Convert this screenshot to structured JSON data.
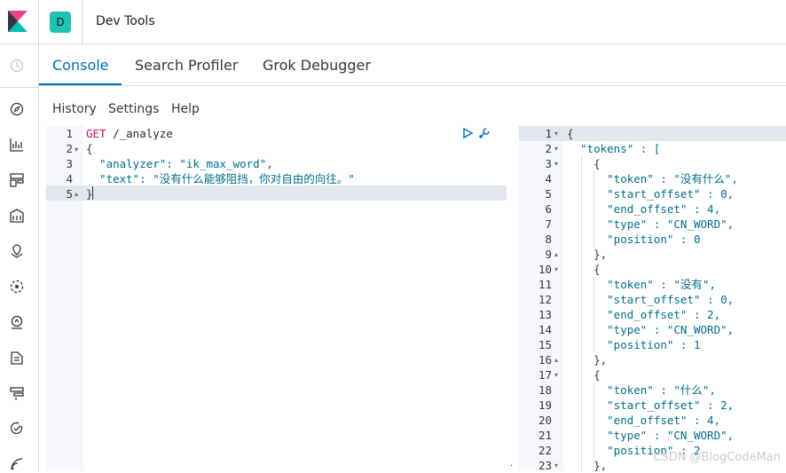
{
  "header": {
    "app_badge": "D",
    "title": "Dev Tools"
  },
  "sidenav": {
    "icons": [
      "clock-icon",
      "compass-icon",
      "visualize-icon",
      "dashboard-icon",
      "canvas-icon",
      "maps-icon",
      "ml-icon",
      "metrics-icon",
      "logs-icon",
      "apm-icon",
      "uptime-icon",
      "siem-icon"
    ]
  },
  "tabs": [
    {
      "label": "Console",
      "active": true
    },
    {
      "label": "Search Profiler",
      "active": false
    },
    {
      "label": "Grok Debugger",
      "active": false
    }
  ],
  "menu": {
    "history": "History",
    "settings": "Settings",
    "help": "Help"
  },
  "request": {
    "line_numbers": [
      "1",
      "2",
      "3",
      "4",
      "5"
    ],
    "method": "GET",
    "path": " /_analyze",
    "lines": [
      "{",
      "  \"analyzer\": \"ik_max_word\",",
      "  \"text\": \"没有什么能够阻挡，你对自由的向往。\"",
      "}"
    ]
  },
  "response": {
    "line_numbers": [
      "1",
      "2",
      "3",
      "4",
      "5",
      "6",
      "7",
      "8",
      "9",
      "10",
      "11",
      "12",
      "13",
      "14",
      "15",
      "16",
      "17",
      "18",
      "19",
      "20",
      "21",
      "22",
      "23"
    ],
    "lines": [
      "{",
      "  \"tokens\" : [",
      "    {",
      "      \"token\" : \"没有什么\",",
      "      \"start_offset\" : 0,",
      "      \"end_offset\" : 4,",
      "      \"type\" : \"CN_WORD\",",
      "      \"position\" : 0",
      "    },",
      "    {",
      "      \"token\" : \"没有\",",
      "      \"start_offset\" : 0,",
      "      \"end_offset\" : 2,",
      "      \"type\" : \"CN_WORD\",",
      "      \"position\" : 1",
      "    },",
      "    {",
      "      \"token\" : \"什么\",",
      "      \"start_offset\" : 2,",
      "      \"end_offset\" : 4,",
      "      \"type\" : \"CN_WORD\",",
      "      \"position\" : 2",
      "    },"
    ]
  },
  "watermark": "CSDN @BlogCodeMan",
  "colors": {
    "accent": "#006bb8",
    "badge": "#20c2b3"
  }
}
